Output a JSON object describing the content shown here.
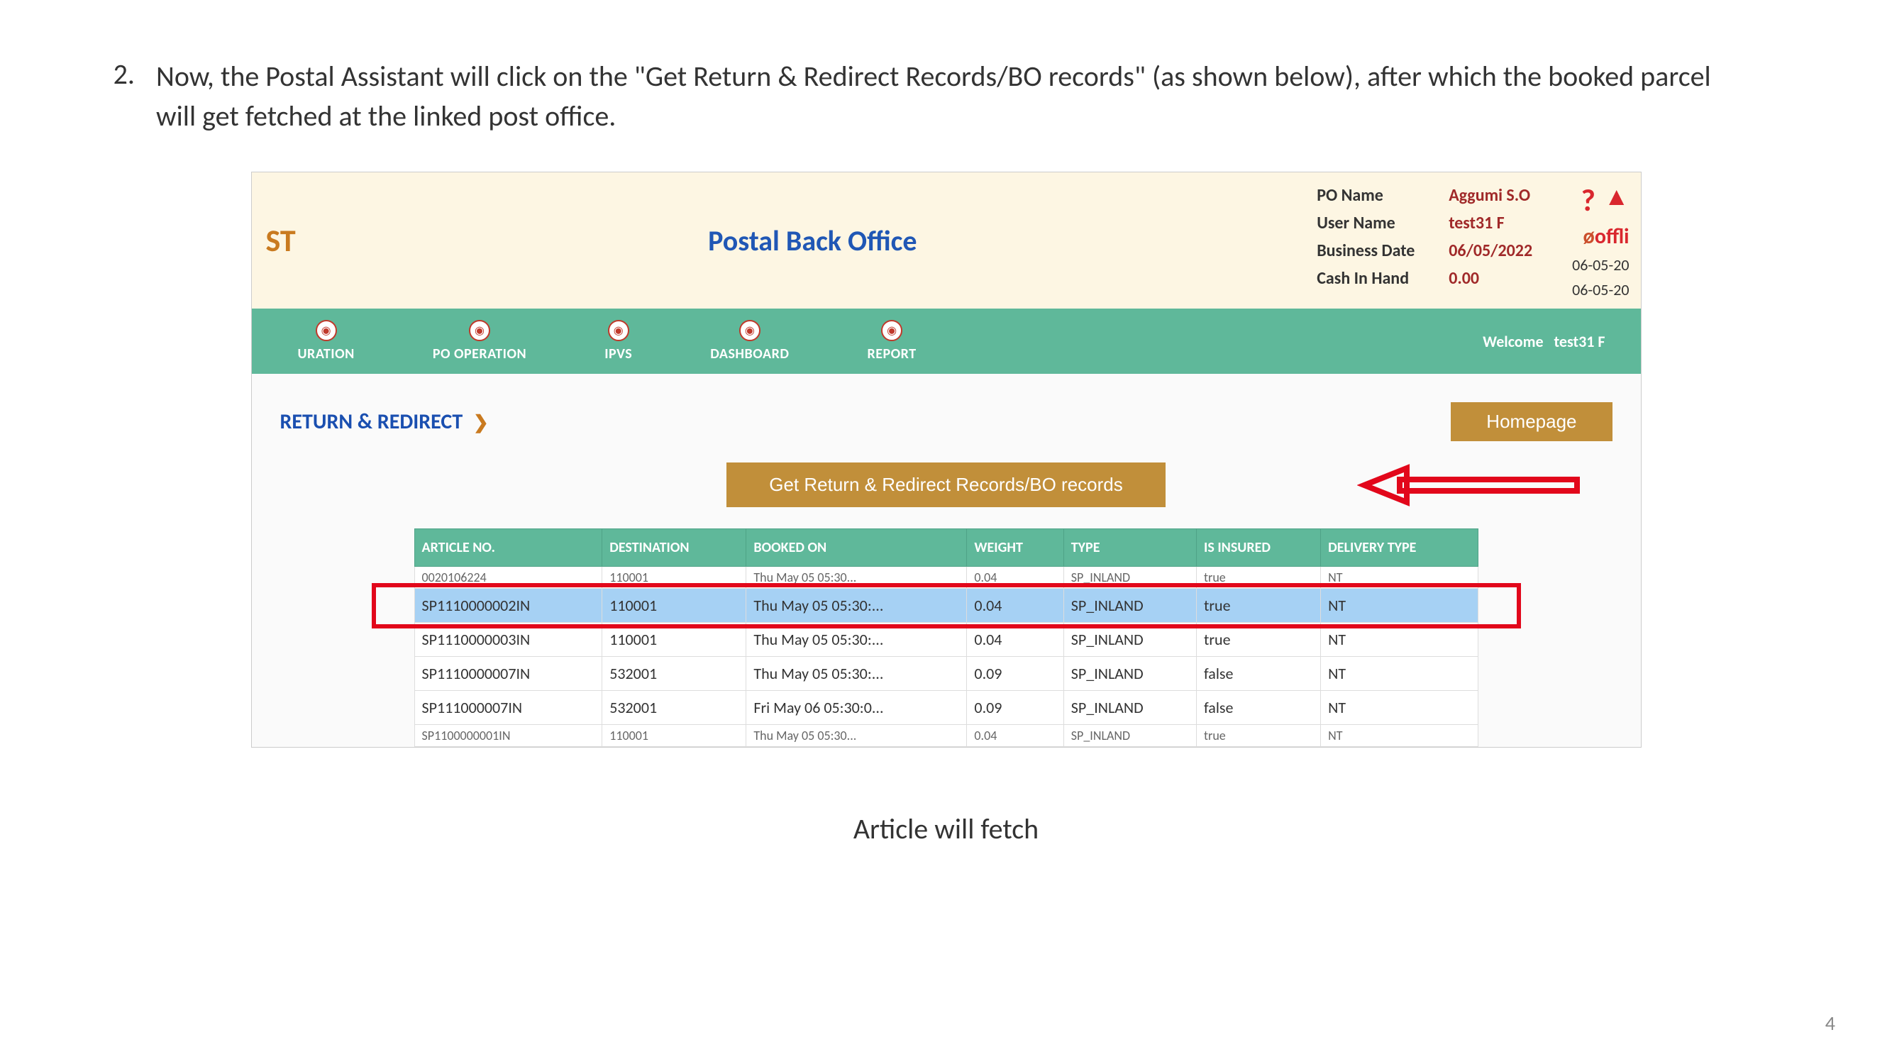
{
  "instruction": {
    "number": "2.",
    "text": "Now, the Postal Assistant will click on the \"Get Return & Redirect Records/BO records\" (as shown below), after which the booked parcel will get fetched at the linked post office."
  },
  "header": {
    "left_fragment": "ST",
    "title": "Postal Back Office",
    "info": {
      "po_name_label": "PO Name",
      "po_name_value": "Aggumi S.O",
      "user_name_label": "User Name",
      "user_name_value": "test31 F",
      "business_date_label": "Business Date",
      "business_date_value": "06/05/2022",
      "cash_label": "Cash In Hand",
      "cash_value": "0.00"
    },
    "right": {
      "offli_text": "offli",
      "date1": "06-05-20",
      "date2": "06-05-20"
    }
  },
  "nav": {
    "items": [
      {
        "label": "URATION"
      },
      {
        "label": "PO OPERATION"
      },
      {
        "label": "IPVS"
      },
      {
        "label": "DASHBOARD"
      },
      {
        "label": "REPORT"
      }
    ],
    "welcome_prefix": "Welcome",
    "welcome_user": "test31 F"
  },
  "section": {
    "title": "RETURN & REDIRECT",
    "homepage_btn": "Homepage",
    "get_btn": "Get Return & Redirect Records/BO records"
  },
  "table": {
    "headers": [
      "ARTICLE NO.",
      "DESTINATION",
      "BOOKED ON",
      "WEIGHT",
      "TYPE",
      "IS INSURED",
      "DELIVERY TYPE"
    ],
    "rows": [
      {
        "partial_top": true,
        "cells": [
          "0020106224",
          "110001",
          "Thu May 05 05:30...",
          "0.04",
          "SP_INLAND",
          "true",
          "NT"
        ]
      },
      {
        "highlighted": true,
        "cells": [
          "SP1110000002IN",
          "110001",
          "Thu May 05 05:30:...",
          "0.04",
          "SP_INLAND",
          "true",
          "NT"
        ]
      },
      {
        "cells": [
          "SP1110000003IN",
          "110001",
          "Thu May 05 05:30:...",
          "0.04",
          "SP_INLAND",
          "true",
          "NT"
        ]
      },
      {
        "cells": [
          "SP1110000007IN",
          "532001",
          "Thu May 05 05:30:...",
          "0.09",
          "SP_INLAND",
          "false",
          "NT"
        ]
      },
      {
        "cells": [
          "SP111000007IN",
          "532001",
          "Fri May 06 05:30:0...",
          "0.09",
          "SP_INLAND",
          "false",
          "NT"
        ]
      },
      {
        "partial_bottom": true,
        "cells": [
          "SP1100000001IN",
          "110001",
          "Thu May 05 05:30...",
          "0.04",
          "SP_INLAND",
          "true",
          "NT"
        ]
      }
    ]
  },
  "caption": "Article will fetch",
  "page_num": "4"
}
